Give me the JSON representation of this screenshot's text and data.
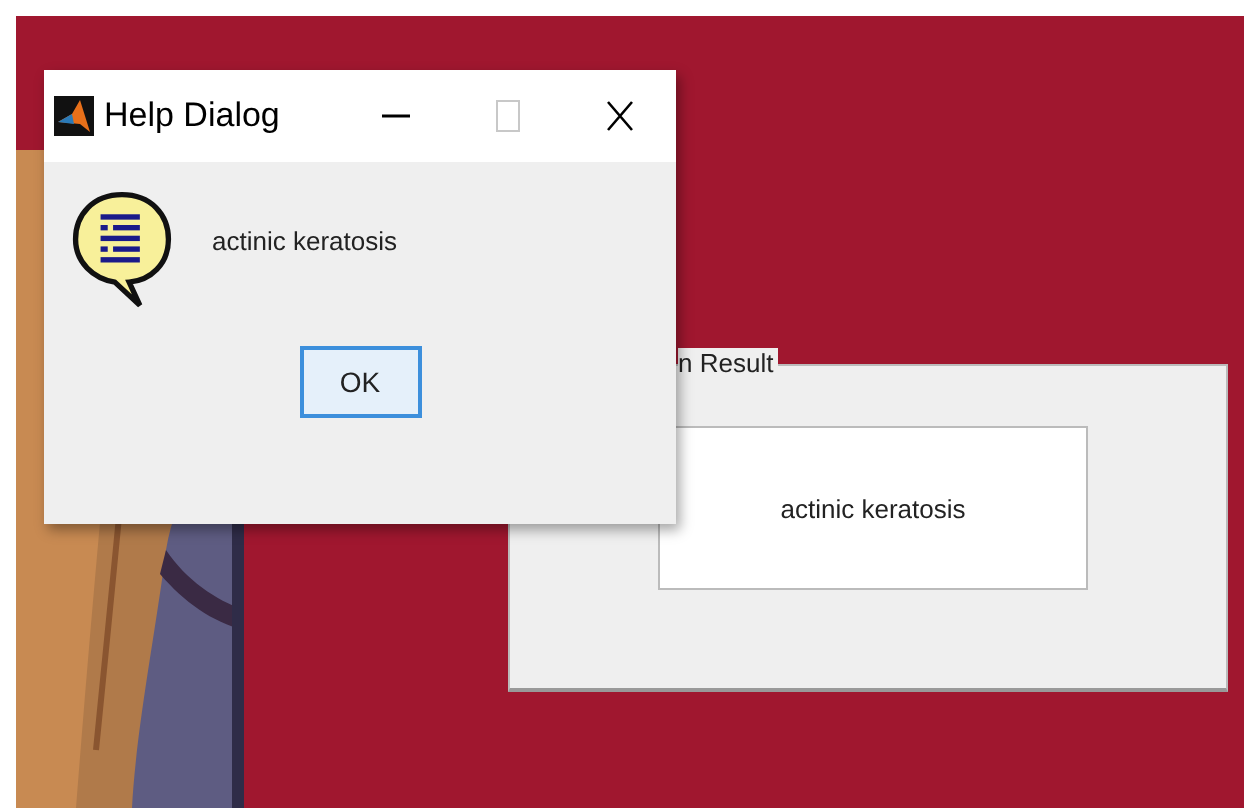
{
  "result_panel": {
    "title": "n Result",
    "value": "actinic keratosis"
  },
  "dialog": {
    "title": "Help Dialog",
    "window_buttons": [
      {
        "kind": "minimize",
        "disabled": false
      },
      {
        "kind": "maximize",
        "disabled": true
      },
      {
        "kind": "close",
        "disabled": false
      }
    ],
    "message": "actinic keratosis",
    "button": "OK"
  }
}
